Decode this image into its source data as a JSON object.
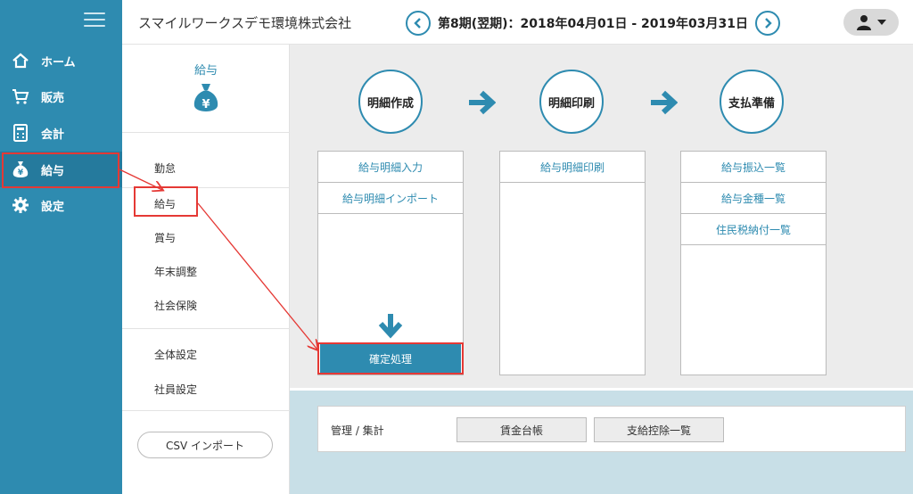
{
  "header": {
    "company": "スマイルワークスデモ環境株式会社",
    "period": "第8期(翌期)：2018年04月01日 - 2019年03月31日"
  },
  "nav": {
    "items": [
      {
        "label": "ホーム",
        "icon": "home-icon"
      },
      {
        "label": "販売",
        "icon": "cart-icon"
      },
      {
        "label": "会計",
        "icon": "calculator-icon"
      },
      {
        "label": "給与",
        "icon": "money-bag-icon"
      },
      {
        "label": "設定",
        "icon": "gear-icon"
      }
    ],
    "active": "給与"
  },
  "submenu": {
    "title": "給与",
    "items": [
      "勤怠",
      "給与",
      "賞与",
      "年末調整",
      "社会保険",
      "全体設定",
      "社員設定"
    ],
    "csv_button": "CSV インポート"
  },
  "steps": [
    {
      "label": "明細作成",
      "links": [
        "給与明細入力",
        "給与明細インポート"
      ]
    },
    {
      "label": "明細印刷",
      "links": [
        "給与明細印刷"
      ]
    },
    {
      "label": "支払準備",
      "links": [
        "給与振込一覧",
        "給与金種一覧",
        "住民税納付一覧"
      ]
    }
  ],
  "confirm_button": "確定処理",
  "manage": {
    "label": "管理 / 集計",
    "buttons": [
      "賃金台帳",
      "支給控除一覧"
    ]
  },
  "colors": {
    "accent": "#2e8bb0",
    "highlight": "#e53935"
  }
}
